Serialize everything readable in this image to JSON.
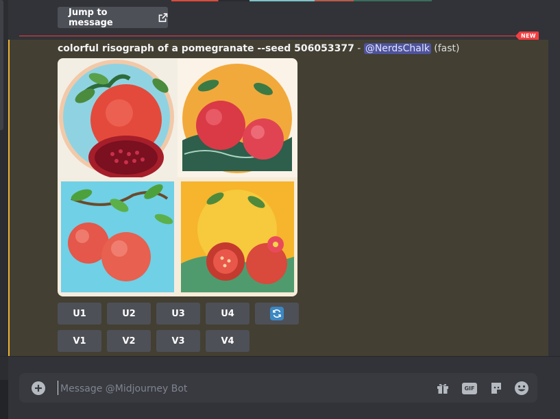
{
  "jump": {
    "label": "Jump to message"
  },
  "divider": {
    "badge": "NEW"
  },
  "message": {
    "prompt": "colorful risograph of a pomegranate --seed 506053377",
    "separator": " - ",
    "mention": "@NerdsChalk",
    "speed": "(fast)"
  },
  "buttons": {
    "upscale": [
      "U1",
      "U2",
      "U3",
      "U4"
    ],
    "variation": [
      "V1",
      "V2",
      "V3",
      "V4"
    ],
    "reroll_icon": "refresh-icon"
  },
  "composer": {
    "placeholder": "Message @Midjourney Bot",
    "icons": [
      "add-circle-icon",
      "gift-icon",
      "gif-icon",
      "sticker-icon",
      "emoji-icon"
    ]
  },
  "colors": {
    "background": "#313338",
    "highlight": "#433f32",
    "highlight_border": "#f0b232",
    "new_red": "#f23f43",
    "button": "#4e5058",
    "mention_bg": "#5865f2"
  }
}
